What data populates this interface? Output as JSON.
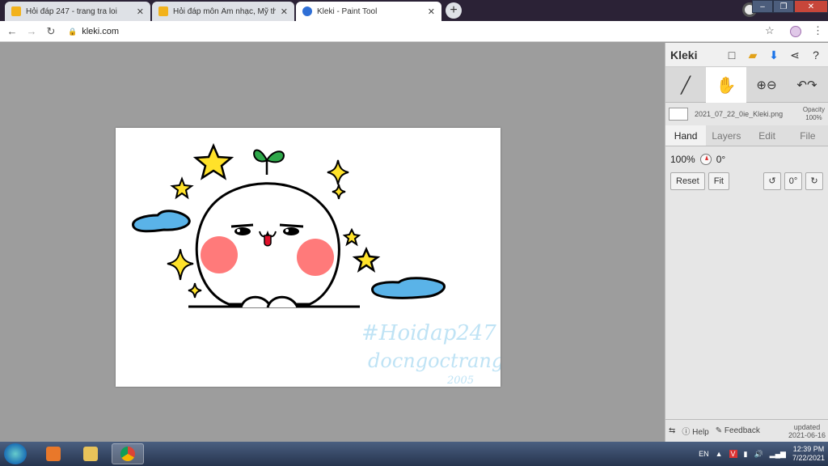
{
  "browser": {
    "tabs": [
      {
        "title": "Hỏi đáp 247 - trang tra loi",
        "active": false
      },
      {
        "title": "Hỏi đáp môn Âm nhạc, Mỹ thuật",
        "active": false
      },
      {
        "title": "Kleki - Paint Tool",
        "active": true
      }
    ],
    "new_tab": "+",
    "url": "kleki.com",
    "window_controls": [
      "–",
      "❐",
      "✕"
    ]
  },
  "kleki": {
    "logo": "Kleki",
    "file": {
      "name": "2021_07_22_0ie_Kleki.png",
      "opacity_label": "Opacity",
      "opacity_value": "100%"
    },
    "tabs": [
      "Hand",
      "Layers",
      "Edit",
      "File"
    ],
    "active_tab": "Hand",
    "hand": {
      "zoom": "100%",
      "angle": "0°",
      "reset": "Reset",
      "fit": "Fit",
      "angle_btn": "0°"
    },
    "footer": {
      "help": "Help",
      "feedback": "Feedback",
      "updated_label": "updated",
      "updated_date": "2021-06-16"
    }
  },
  "drawing": {
    "watermark_line1": "#Hoidap247",
    "watermark_line2": "docngoctrang",
    "watermark_line3": "2005"
  },
  "taskbar": {
    "lang": "EN",
    "time": "12:39 PM",
    "date": "7/22/2021"
  }
}
